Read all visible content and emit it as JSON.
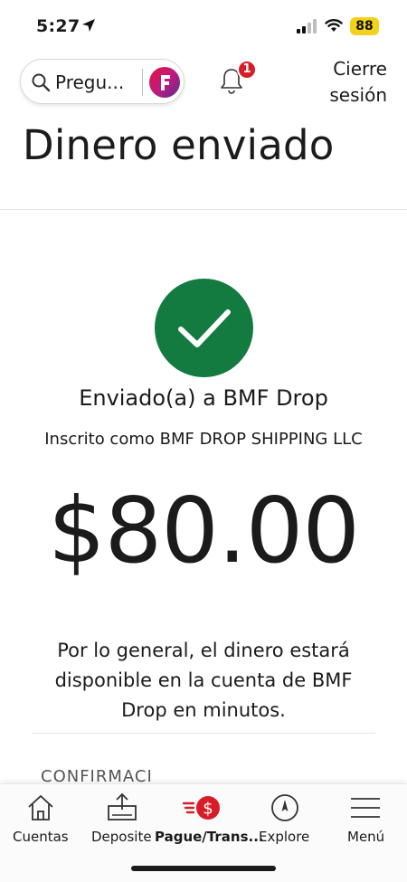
{
  "status_bar": {
    "time": "5:27",
    "battery": "88"
  },
  "header": {
    "search_placeholder": "Pregu...",
    "notification_count": "1",
    "logout_label": "Cierre sesión",
    "title": "Dinero enviado"
  },
  "confirmation": {
    "sent_to": "Enviado(a) a BMF Drop",
    "enrolled_as": "Inscrito como BMF DROP SHIPPING LLC",
    "amount": "$80.00",
    "info": "Por lo general, el dinero estará disponible en la cuenta de BMF Drop en minutos.",
    "section_heading": "CONFIRMACI"
  },
  "colors": {
    "success": "#137a40",
    "badge": "#d71e28",
    "brand_gradient": [
      "#e0163d",
      "#5c2c91"
    ]
  },
  "bottom_nav": {
    "items": [
      {
        "label": "Cuentas",
        "icon": "home-icon",
        "active": false
      },
      {
        "label": "Deposite",
        "icon": "deposit-check-icon",
        "active": false
      },
      {
        "label": "Pague/Trans...",
        "icon": "pay-transfer-icon",
        "active": true
      },
      {
        "label": "Explore",
        "icon": "compass-icon",
        "active": false
      },
      {
        "label": "Menú",
        "icon": "hamburger-menu-icon",
        "active": false
      }
    ]
  }
}
